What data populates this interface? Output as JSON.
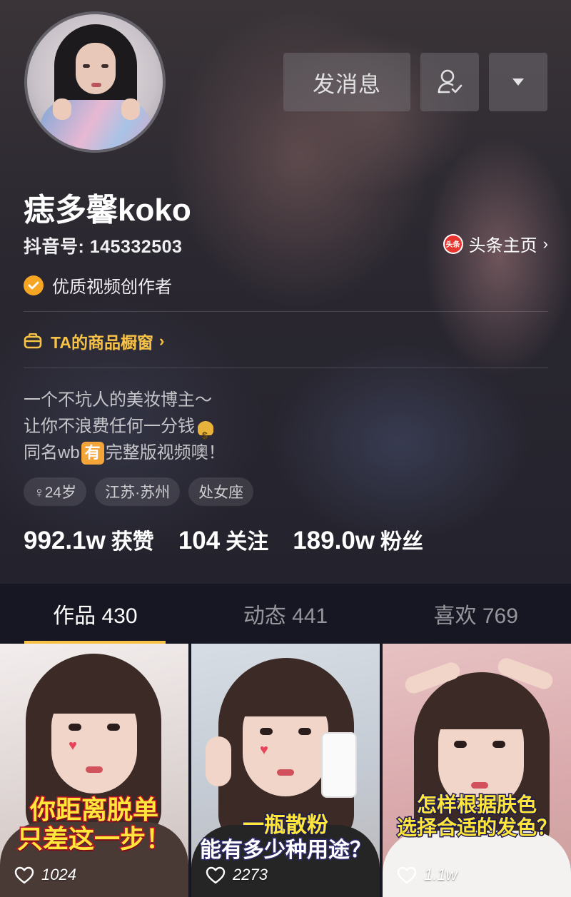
{
  "profile": {
    "name": "痣多馨koko",
    "douyin_id": "抖音号: 145332503",
    "toutiao_link": "头条主页",
    "toutiao_logo_text": "头条",
    "verified_label": "优质视频创作者",
    "shop_link": "TA的商品橱窗",
    "bio": {
      "line1": "一个不坑人的美妆博主～",
      "line2": "让你不浪费任何一分钱",
      "line3_prefix": "同名wb",
      "line3_badge": "有",
      "line3_suffix": "完整版视频噢！"
    },
    "tags": [
      "♀24岁",
      "江苏·苏州",
      "处女座"
    ]
  },
  "actions": {
    "message_label": "发消息"
  },
  "stats": {
    "likes": {
      "num": "992.1w",
      "label": "获赞"
    },
    "following": {
      "num": "104",
      "label": "关注"
    },
    "followers": {
      "num": "189.0w",
      "label": "粉丝"
    }
  },
  "tabs": [
    {
      "label": "作品 430",
      "active": true
    },
    {
      "label": "动态 441",
      "active": false
    },
    {
      "label": "喜欢 769",
      "active": false
    }
  ],
  "videos": [
    {
      "caption_line1": "你距离脱单",
      "caption_line2": "只差这一步！",
      "likes": "1024"
    },
    {
      "caption_line1": "一瓶散粉",
      "caption_line2": "能有多少种用途？",
      "likes": "2273"
    },
    {
      "caption_line1": "怎样根据肤色",
      "caption_line2": "选择合适的发色？",
      "likes": "1.1w"
    }
  ],
  "colors": {
    "accent": "#f7c245",
    "background": "#161722",
    "toutiao_red": "#e8342e",
    "verified_orange": "#f6a623"
  },
  "icons": {
    "user_check": "user-check-icon",
    "dropdown": "caret-down-icon",
    "shop": "shop-icon",
    "heart": "heart-outline-icon"
  }
}
